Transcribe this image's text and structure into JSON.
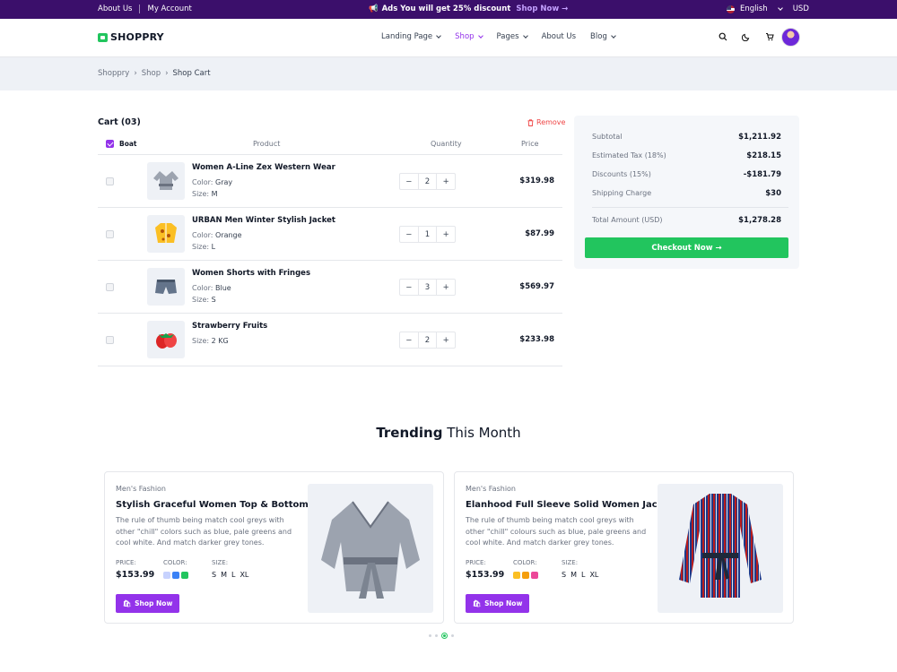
{
  "topbar": {
    "links": [
      "About Us",
      "My Account"
    ],
    "promo_icon": "megaphone-icon",
    "promo_text": "Ads You will get 25% discount",
    "promo_cta": "Shop Now →",
    "language": "English",
    "currency": "USD"
  },
  "header": {
    "brand": "SHOPPRY",
    "nav": [
      {
        "label": "Landing Page",
        "dropdown": true
      },
      {
        "label": "Shop",
        "dropdown": true,
        "active": true
      },
      {
        "label": "Pages",
        "dropdown": true
      },
      {
        "label": "About Us",
        "dropdown": false
      },
      {
        "label": "Blog",
        "dropdown": true
      }
    ],
    "icons": [
      "search-icon",
      "moon-icon",
      "cart-icon"
    ]
  },
  "breadcrumb": [
    "Shoppry",
    "›",
    "Shop",
    "›",
    "Shop Cart"
  ],
  "cart": {
    "title": "Cart (03)",
    "remove_label": "Remove",
    "columns": {
      "select": "Boat",
      "product": "Product",
      "quantity": "Quantity",
      "price": "Price"
    },
    "items": [
      {
        "name": "Women A-Line Zex Western Wear",
        "attrs": [
          {
            "k": "Color:",
            "v": "Gray"
          },
          {
            "k": "Size:",
            "v": "M"
          }
        ],
        "qty": "2",
        "price": "$319.98"
      },
      {
        "name": "URBAN Men Winter Stylish Jacket",
        "attrs": [
          {
            "k": "Color:",
            "v": "Orange"
          },
          {
            "k": "Size:",
            "v": "L"
          }
        ],
        "qty": "1",
        "price": "$87.99"
      },
      {
        "name": "Women Shorts with Fringes",
        "attrs": [
          {
            "k": "Color:",
            "v": "Blue"
          },
          {
            "k": "Size:",
            "v": "S"
          }
        ],
        "qty": "3",
        "price": "$569.97"
      },
      {
        "name": "Strawberry Fruits",
        "attrs": [
          {
            "k": "Size:",
            "v": "2 KG"
          }
        ],
        "qty": "2",
        "price": "$233.98"
      }
    ]
  },
  "summary": {
    "subtotal_label": "Subtotal",
    "subtotal": "$1,211.92",
    "tax_label": "Estimated Tax (18%)",
    "tax": "$218.15",
    "discount_label": "Discounts (15%)",
    "discount": "-$181.79",
    "shipping_label": "Shipping Charge",
    "shipping": "$30",
    "total_label": "Total Amount (USD)",
    "total": "$1,278.28",
    "checkout_label": "Checkout Now →"
  },
  "trending": {
    "title_bold": "Trending",
    "title_rest": " This Month",
    "cards": [
      {
        "category": "Men's Fashion",
        "title": "Stylish Graceful Women Top & Bottom Sets",
        "desc": "The rule of thumb being match cool greys with other \"chill\" colors such as blue, pale greens and cool white. And match darker grey tones.",
        "price_label": "PRICE:",
        "price": "$153.99",
        "color_label": "COLOR:",
        "colors": [
          "#c7d2fe",
          "#3b82f6",
          "#22c55e"
        ],
        "size_label": "SIZE:",
        "sizes": [
          "S",
          "M",
          "L",
          "XL"
        ],
        "cta": "Shop Now"
      },
      {
        "category": "Men's Fashion",
        "title": "Elanhood Full Sleeve Solid Women Jacket",
        "desc": "The rule of thumb being match cool greys with other \"chill\" colours such as blue, pale greens and cool white. And match darker grey tones.",
        "price_label": "PRICE:",
        "price": "$153.99",
        "color_label": "COLOR:",
        "colors": [
          "#fbbf24",
          "#f59e0b",
          "#ec4899"
        ],
        "size_label": "SIZE:",
        "sizes": [
          "S",
          "M",
          "L",
          "XL"
        ],
        "cta": "Shop Now"
      }
    ]
  },
  "colors": {
    "accent": "#9333ea",
    "checkout": "#22c55e",
    "topbar": "#3b0f6b",
    "remove": "#ef4444"
  }
}
